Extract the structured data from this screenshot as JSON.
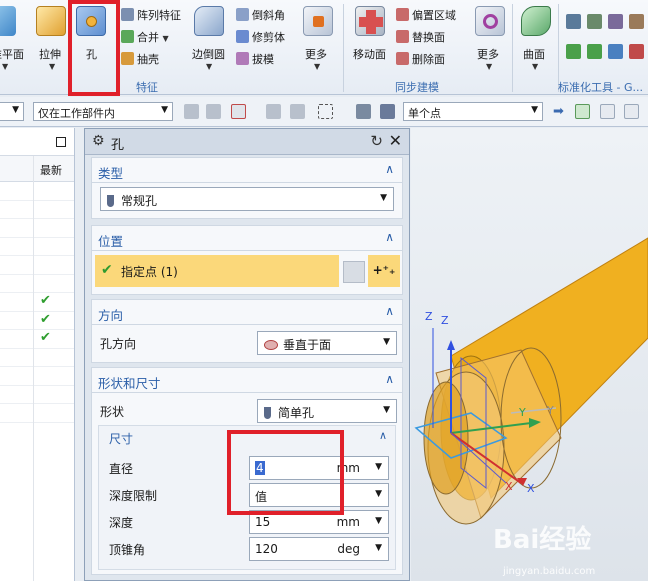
{
  "ribbon": {
    "datum_plane": "准平面",
    "extrude": "拉伸",
    "hole": "孔",
    "pattern_feature": "阵列特征",
    "unite": "合并",
    "shell": "抽壳",
    "edge_blend": "边倒圆",
    "chamfer": "倒斜角",
    "trim_body": "修剪体",
    "draft": "拔模",
    "more": "更多",
    "move_face": "移动面",
    "offset_region": "偏置区域",
    "replace_face": "替换面",
    "delete_face": "删除面",
    "surface": "曲面",
    "groups": {
      "feature": "特征",
      "sync_modeling": "同步建模",
      "std_tools": "标准化工具 - G..."
    }
  },
  "toolbar": {
    "work_part_filter": "仅在工作部件内",
    "snap_mode": "单个点"
  },
  "navigator": {
    "col_latest": "最新",
    "check_mark": "✔"
  },
  "dialog": {
    "title": "孔",
    "sections": {
      "type": {
        "header": "类型",
        "value": "常规孔"
      },
      "location": {
        "header": "位置",
        "specify_point": "指定点 (1)"
      },
      "direction": {
        "header": "方向",
        "label": "孔方向",
        "value": "垂直于面"
      },
      "form": {
        "header": "形状和尺寸",
        "shape_label": "形状",
        "shape_value": "简单孔",
        "dimensions": {
          "header": "尺寸",
          "diameter_label": "直径",
          "diameter_value": "4",
          "diameter_unit": "mm",
          "depth_limit_label": "深度限制",
          "depth_limit_value": "值",
          "depth_label": "深度",
          "depth_value": "15",
          "depth_unit": "mm",
          "tip_angle_label": "顶锥角",
          "tip_angle_value": "120",
          "tip_angle_unit": "deg"
        }
      }
    }
  },
  "viewport": {
    "axis_x": "X",
    "axis_y": "Y",
    "axis_z": "Z",
    "watermark": "Bai经验",
    "watermark_url": "jingyan.baidu.com"
  }
}
